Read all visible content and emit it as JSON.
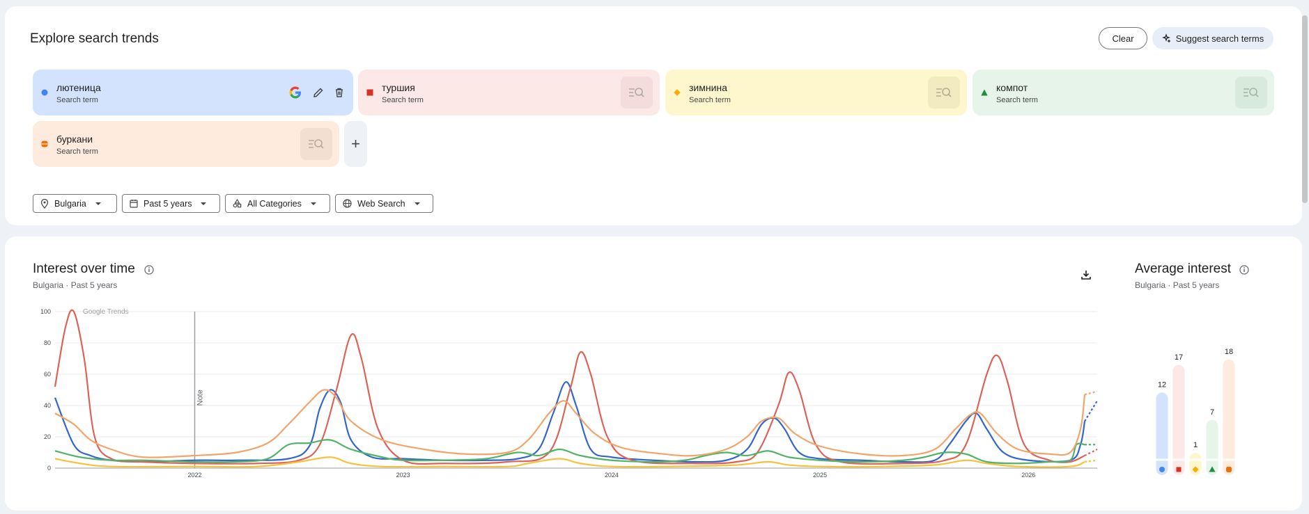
{
  "header": {
    "title": "Explore search trends",
    "clear_label": "Clear",
    "suggest_label": "Suggest search terms"
  },
  "terms": [
    {
      "name": "лютеница",
      "sub": "Search term",
      "color": "#4285f4",
      "bg": "#d3e3fd",
      "marker": "circle"
    },
    {
      "name": "туршия",
      "sub": "Search term",
      "color": "#d93025",
      "bg": "#fce8e6",
      "marker": "square"
    },
    {
      "name": "зимнина",
      "sub": "Search term",
      "color": "#f9ab00",
      "bg": "#fef7cd",
      "marker": "diamond"
    },
    {
      "name": "компот",
      "sub": "Search term",
      "color": "#1e8e3e",
      "bg": "#e6f4ea",
      "marker": "triangle"
    },
    {
      "name": "буркани",
      "sub": "Search term",
      "color": "#e8710a",
      "bg": "#feebdd",
      "marker": "hourglass"
    }
  ],
  "filters": {
    "location": "Bulgaria",
    "time": "Past 5 years",
    "category": "All Categories",
    "property": "Web Search"
  },
  "interest_over_time": {
    "title": "Interest over time",
    "sub_location": "Bulgaria",
    "sub_time": "Past 5 years",
    "watermark": "Google Trends",
    "note_label": "Note"
  },
  "average_interest": {
    "title": "Average interest",
    "sub_location": "Bulgaria",
    "sub_time": "Past 5 years"
  },
  "chart_data": [
    {
      "type": "line",
      "title": "Interest over time",
      "ylim": [
        0,
        100
      ],
      "yticks": [
        0,
        20,
        40,
        60,
        80,
        100
      ],
      "xlim": [
        2021.33,
        2026.33
      ],
      "xticks": [
        {
          "v": 2022,
          "label": "2022"
        },
        {
          "v": 2023,
          "label": "2023"
        },
        {
          "v": 2024,
          "label": "2024"
        },
        {
          "v": 2025,
          "label": "2025"
        },
        {
          "v": 2026,
          "label": "2026"
        }
      ],
      "grid": true,
      "note_at": 2022,
      "partial_from": 2026.27,
      "series": [
        {
          "name": "лютеница",
          "color": "#3366cc",
          "points": [
            [
              2021.33,
              45
            ],
            [
              2021.42,
              15
            ],
            [
              2021.5,
              8
            ],
            [
              2021.6,
              5
            ],
            [
              2021.75,
              4
            ],
            [
              2022,
              5
            ],
            [
              2022.2,
              5
            ],
            [
              2022.45,
              6
            ],
            [
              2022.55,
              14
            ],
            [
              2022.6,
              38
            ],
            [
              2022.65,
              50
            ],
            [
              2022.7,
              42
            ],
            [
              2022.75,
              18
            ],
            [
              2022.85,
              7
            ],
            [
              2023,
              6
            ],
            [
              2023.2,
              5
            ],
            [
              2023.4,
              5
            ],
            [
              2023.55,
              6
            ],
            [
              2023.65,
              12
            ],
            [
              2023.72,
              35
            ],
            [
              2023.78,
              55
            ],
            [
              2023.83,
              40
            ],
            [
              2023.9,
              12
            ],
            [
              2024,
              7
            ],
            [
              2024.2,
              5
            ],
            [
              2024.4,
              4
            ],
            [
              2024.55,
              5
            ],
            [
              2024.65,
              12
            ],
            [
              2024.72,
              28
            ],
            [
              2024.78,
              32
            ],
            [
              2024.83,
              25
            ],
            [
              2024.9,
              10
            ],
            [
              2025,
              6
            ],
            [
              2025.2,
              5
            ],
            [
              2025.4,
              4
            ],
            [
              2025.55,
              5
            ],
            [
              2025.62,
              15
            ],
            [
              2025.7,
              30
            ],
            [
              2025.75,
              35
            ],
            [
              2025.8,
              25
            ],
            [
              2025.88,
              10
            ],
            [
              2026,
              5
            ],
            [
              2026.2,
              5
            ],
            [
              2026.25,
              15
            ],
            [
              2026.27,
              30
            ]
          ],
          "partial": [
            [
              2026.27,
              30
            ],
            [
              2026.33,
              43
            ]
          ]
        },
        {
          "name": "туршия",
          "color": "#db6357",
          "points": [
            [
              2021.33,
              52
            ],
            [
              2021.38,
              90
            ],
            [
              2021.42,
              100
            ],
            [
              2021.47,
              70
            ],
            [
              2021.52,
              20
            ],
            [
              2021.6,
              6
            ],
            [
              2021.75,
              4
            ],
            [
              2022,
              3
            ],
            [
              2022.3,
              3
            ],
            [
              2022.5,
              5
            ],
            [
              2022.6,
              15
            ],
            [
              2022.68,
              50
            ],
            [
              2022.75,
              85
            ],
            [
              2022.8,
              70
            ],
            [
              2022.88,
              25
            ],
            [
              2023,
              5
            ],
            [
              2023.2,
              3
            ],
            [
              2023.5,
              4
            ],
            [
              2023.7,
              10
            ],
            [
              2023.8,
              50
            ],
            [
              2023.85,
              74
            ],
            [
              2023.9,
              60
            ],
            [
              2023.98,
              20
            ],
            [
              2024.1,
              5
            ],
            [
              2024.4,
              3
            ],
            [
              2024.6,
              4
            ],
            [
              2024.7,
              10
            ],
            [
              2024.8,
              40
            ],
            [
              2024.85,
              61
            ],
            [
              2024.9,
              50
            ],
            [
              2024.98,
              15
            ],
            [
              2025.1,
              4
            ],
            [
              2025.4,
              3
            ],
            [
              2025.6,
              5
            ],
            [
              2025.7,
              15
            ],
            [
              2025.8,
              60
            ],
            [
              2025.85,
              72
            ],
            [
              2025.9,
              55
            ],
            [
              2025.98,
              15
            ],
            [
              2026.1,
              5
            ],
            [
              2026.2,
              4
            ],
            [
              2026.27,
              8
            ]
          ],
          "partial": [
            [
              2026.27,
              8
            ],
            [
              2026.33,
              12
            ]
          ]
        },
        {
          "name": "зимнина",
          "color": "#f7c23b",
          "points": [
            [
              2021.33,
              6
            ],
            [
              2021.45,
              3
            ],
            [
              2021.6,
              1
            ],
            [
              2022,
              1
            ],
            [
              2022.3,
              1
            ],
            [
              2022.5,
              4
            ],
            [
              2022.65,
              7
            ],
            [
              2022.75,
              3
            ],
            [
              2022.9,
              1
            ],
            [
              2023.2,
              1
            ],
            [
              2023.5,
              1
            ],
            [
              2023.6,
              3
            ],
            [
              2023.75,
              6
            ],
            [
              2023.85,
              3
            ],
            [
              2024,
              1
            ],
            [
              2024.3,
              1
            ],
            [
              2024.6,
              2
            ],
            [
              2024.75,
              4
            ],
            [
              2024.85,
              2
            ],
            [
              2025,
              1
            ],
            [
              2025.3,
              1
            ],
            [
              2025.55,
              2
            ],
            [
              2025.7,
              5
            ],
            [
              2025.8,
              3
            ],
            [
              2025.95,
              1
            ],
            [
              2026.2,
              1
            ],
            [
              2026.27,
              4
            ]
          ],
          "partial": [
            [
              2026.27,
              4
            ],
            [
              2026.33,
              5
            ]
          ]
        },
        {
          "name": "компот",
          "color": "#50b365",
          "points": [
            [
              2021.33,
              11
            ],
            [
              2021.45,
              7
            ],
            [
              2021.6,
              5
            ],
            [
              2021.75,
              5
            ],
            [
              2022,
              4
            ],
            [
              2022.2,
              4
            ],
            [
              2022.35,
              6
            ],
            [
              2022.45,
              15
            ],
            [
              2022.55,
              16
            ],
            [
              2022.65,
              18
            ],
            [
              2022.75,
              12
            ],
            [
              2022.9,
              7
            ],
            [
              2023,
              5
            ],
            [
              2023.2,
              5
            ],
            [
              2023.4,
              6
            ],
            [
              2023.55,
              10
            ],
            [
              2023.65,
              8
            ],
            [
              2023.75,
              12
            ],
            [
              2023.85,
              8
            ],
            [
              2024,
              5
            ],
            [
              2024.2,
              4
            ],
            [
              2024.35,
              5
            ],
            [
              2024.45,
              8
            ],
            [
              2024.55,
              10
            ],
            [
              2024.65,
              8
            ],
            [
              2024.75,
              11
            ],
            [
              2024.85,
              7
            ],
            [
              2025,
              5
            ],
            [
              2025.2,
              4
            ],
            [
              2025.4,
              5
            ],
            [
              2025.5,
              7
            ],
            [
              2025.6,
              10
            ],
            [
              2025.7,
              9
            ],
            [
              2025.8,
              4
            ],
            [
              2025.95,
              3
            ],
            [
              2026.1,
              4
            ],
            [
              2026.2,
              5
            ],
            [
              2026.23,
              15
            ],
            [
              2026.27,
              15
            ]
          ],
          "partial": [
            [
              2026.27,
              15
            ],
            [
              2026.33,
              15
            ]
          ]
        },
        {
          "name": "буркани",
          "color": "#f2a46a",
          "points": [
            [
              2021.33,
              35
            ],
            [
              2021.42,
              28
            ],
            [
              2021.5,
              18
            ],
            [
              2021.6,
              12
            ],
            [
              2021.75,
              7
            ],
            [
              2022,
              8
            ],
            [
              2022.2,
              10
            ],
            [
              2022.35,
              16
            ],
            [
              2022.45,
              28
            ],
            [
              2022.55,
              42
            ],
            [
              2022.62,
              50
            ],
            [
              2022.68,
              45
            ],
            [
              2022.75,
              30
            ],
            [
              2022.9,
              18
            ],
            [
              2023.1,
              12
            ],
            [
              2023.3,
              9
            ],
            [
              2023.5,
              10
            ],
            [
              2023.6,
              18
            ],
            [
              2023.7,
              35
            ],
            [
              2023.77,
              43
            ],
            [
              2023.83,
              35
            ],
            [
              2023.92,
              22
            ],
            [
              2024.05,
              13
            ],
            [
              2024.25,
              9
            ],
            [
              2024.4,
              8
            ],
            [
              2024.55,
              12
            ],
            [
              2024.65,
              20
            ],
            [
              2024.72,
              30
            ],
            [
              2024.8,
              32
            ],
            [
              2024.88,
              22
            ],
            [
              2025,
              14
            ],
            [
              2025.2,
              9
            ],
            [
              2025.4,
              8
            ],
            [
              2025.55,
              12
            ],
            [
              2025.65,
              25
            ],
            [
              2025.72,
              34
            ],
            [
              2025.77,
              35
            ],
            [
              2025.85,
              22
            ],
            [
              2025.95,
              12
            ],
            [
              2026.1,
              9
            ],
            [
              2026.2,
              10
            ],
            [
              2026.25,
              25
            ],
            [
              2026.27,
              47
            ]
          ],
          "partial": [
            [
              2026.27,
              47
            ],
            [
              2026.33,
              49
            ]
          ]
        }
      ]
    },
    {
      "type": "bar",
      "title": "Average interest",
      "categories": [
        "лютеница",
        "туршия",
        "зимнина",
        "компот",
        "буркани"
      ],
      "values": [
        12,
        17,
        1,
        7,
        18
      ],
      "ylim": [
        0,
        18
      ]
    }
  ]
}
